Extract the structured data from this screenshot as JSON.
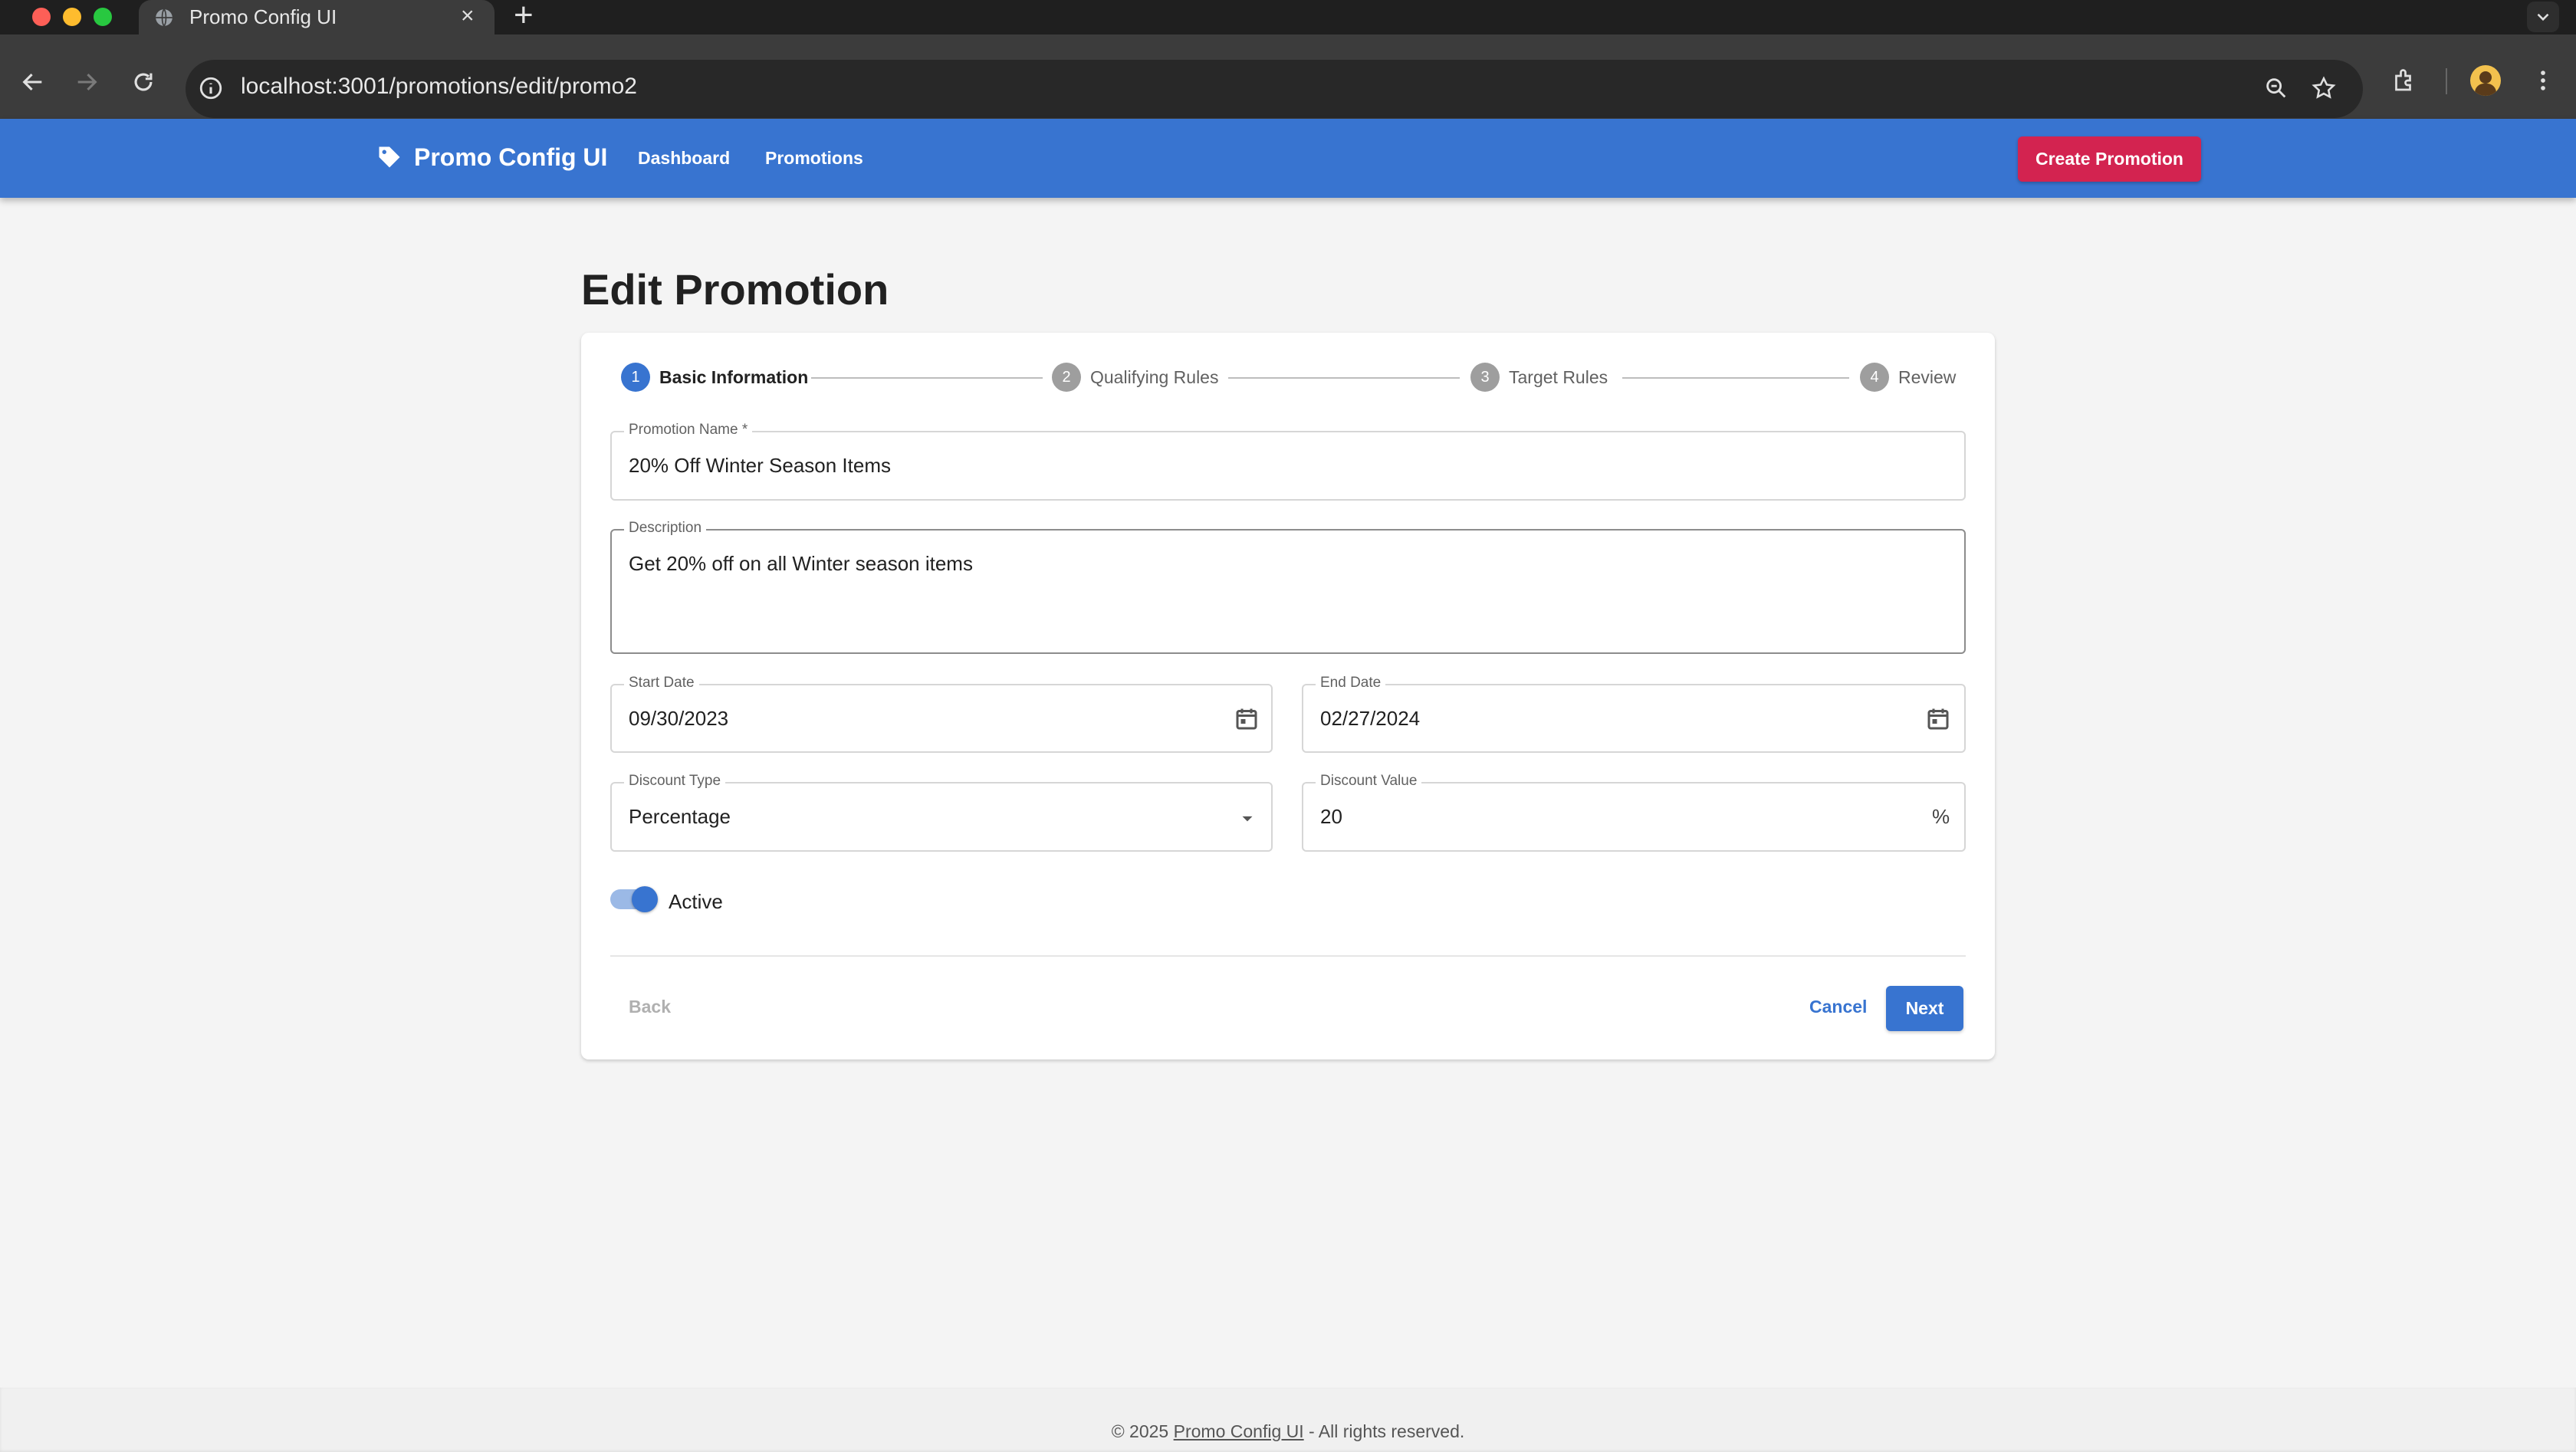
{
  "browser": {
    "tab_title": "Promo Config UI",
    "url": "localhost:3001/promotions/edit/promo2"
  },
  "header": {
    "brand": "Promo Config UI",
    "nav": [
      "Dashboard",
      "Promotions"
    ],
    "create_button": "Create Promotion"
  },
  "page": {
    "title": "Edit Promotion"
  },
  "stepper": {
    "steps": [
      {
        "number": "1",
        "label": "Basic Information"
      },
      {
        "number": "2",
        "label": "Qualifying Rules"
      },
      {
        "number": "3",
        "label": "Target Rules"
      },
      {
        "number": "4",
        "label": "Review"
      }
    ],
    "active_step": 1
  },
  "form": {
    "promotion_name": {
      "label": "Promotion Name *",
      "value": "20% Off Winter Season Items"
    },
    "description": {
      "label": "Description",
      "value": "Get 20% off on all Winter season items"
    },
    "start_date": {
      "label": "Start Date",
      "value": "09/30/2023"
    },
    "end_date": {
      "label": "End Date",
      "value": "02/27/2024"
    },
    "discount_type": {
      "label": "Discount Type",
      "value": "Percentage"
    },
    "discount_value": {
      "label": "Discount Value",
      "value": "20",
      "suffix": "%"
    },
    "active": {
      "label": "Active",
      "checked": true
    }
  },
  "actions": {
    "back": "Back",
    "cancel": "Cancel",
    "next": "Next"
  },
  "footer": {
    "prefix": "© 2025 ",
    "link": "Promo Config UI",
    "suffix": " - All rights reserved."
  },
  "colors": {
    "primary": "#3874d0",
    "accent": "#d32350",
    "background": "#f4f4f4"
  }
}
